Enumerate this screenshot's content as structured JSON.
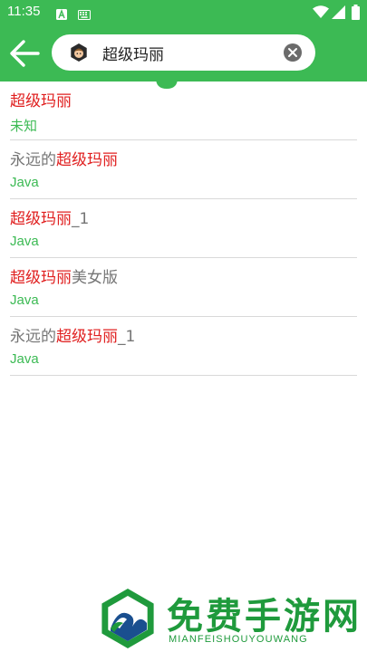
{
  "status_bar": {
    "time": "11:35",
    "icons": [
      "android-notification-icon",
      "keyboard-icon",
      "wifi-icon",
      "cellular-signal-icon",
      "battery-icon"
    ]
  },
  "app_bar": {
    "back_icon": "arrow-left-icon",
    "search": {
      "value": "超级玛丽",
      "avatar_icon": "character-avatar-icon",
      "clear_icon": "clear-circle-icon"
    }
  },
  "results": [
    {
      "pre": "",
      "highlight": "超级玛丽",
      "post": "",
      "subtitle": "未知"
    },
    {
      "pre": "永远的",
      "highlight": "超级玛丽",
      "post": "",
      "subtitle": "Java"
    },
    {
      "pre": "",
      "highlight": "超级玛丽",
      "post": "_1",
      "subtitle": "Java"
    },
    {
      "pre": "",
      "highlight": "超级玛丽",
      "post": "美女版",
      "subtitle": "Java"
    },
    {
      "pre": "永远的",
      "highlight": "超级玛丽",
      "post": "_1",
      "subtitle": "Java"
    }
  ],
  "watermark": {
    "title": "免费手游网",
    "subtitle": "MIANFEISHOUYOUWANG"
  },
  "colors": {
    "primary": "#3cba54",
    "highlight": "#e02020",
    "text_gray": "#757575",
    "watermark": "#1f9a3c"
  }
}
